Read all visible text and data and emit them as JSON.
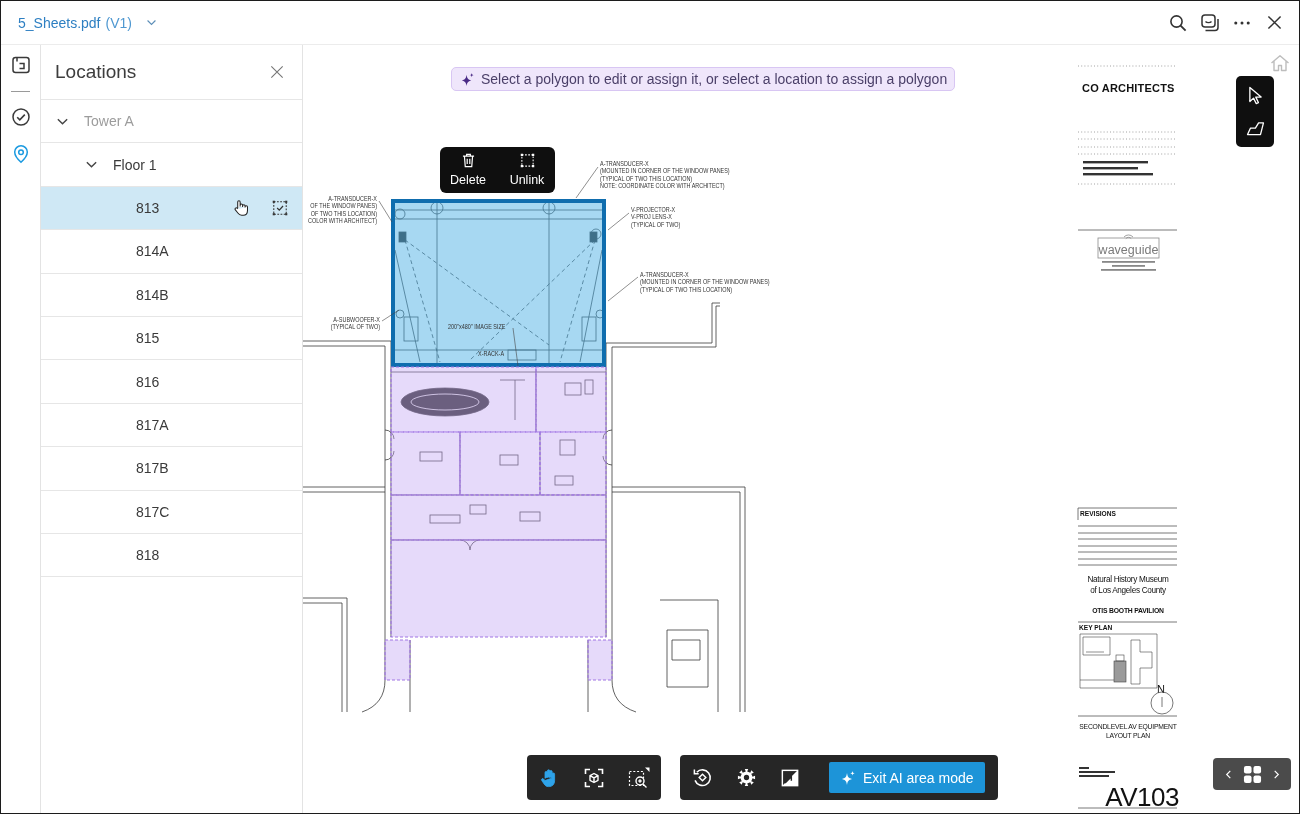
{
  "header": {
    "file_name": "5_Sheets.pdf",
    "version": "(V1)"
  },
  "rail": [
    {
      "kind": "sheets",
      "selected": false
    },
    {
      "kind": "issues",
      "selected": false
    },
    {
      "kind": "locations",
      "selected": true
    }
  ],
  "panel": {
    "title": "Locations",
    "tree": [
      {
        "label": "Tower A",
        "expanded": true,
        "selected": false,
        "disabled": true,
        "children": [
          {
            "label": "Floor 1",
            "expanded": true,
            "selected": false,
            "disabled": false,
            "children": [
              {
                "label": "813",
                "selected": true,
                "disabled": false,
                "hovered": true,
                "linked": true
              },
              {
                "label": "814A",
                "selected": false,
                "disabled": false,
                "hovered": false,
                "linked": false
              },
              {
                "label": "814B",
                "selected": false,
                "disabled": false,
                "hovered": false,
                "linked": false
              },
              {
                "label": "815",
                "selected": false,
                "disabled": false,
                "hovered": false,
                "linked": false
              },
              {
                "label": "816",
                "selected": false,
                "disabled": false,
                "hovered": false,
                "linked": false
              },
              {
                "label": "817A",
                "selected": false,
                "disabled": false,
                "hovered": false,
                "linked": false
              },
              {
                "label": "817B",
                "selected": false,
                "disabled": false,
                "hovered": false,
                "linked": false
              },
              {
                "label": "817C",
                "selected": false,
                "disabled": false,
                "hovered": false,
                "linked": false
              },
              {
                "label": "818",
                "selected": false,
                "disabled": false,
                "hovered": false,
                "linked": false
              }
            ]
          }
        ]
      }
    ]
  },
  "canvas": {
    "hint": "Select a polygon to edit or assign it, or select a location to assign a polygon",
    "polygon_menu": [
      {
        "kind": "delete",
        "label": "Delete"
      },
      {
        "kind": "unlink",
        "label": "Unlink"
      }
    ],
    "tools": [
      {
        "kind": "select"
      },
      {
        "kind": "polygon"
      }
    ],
    "sheet": {
      "polygons": [
        {
          "selected": true
        },
        {
          "selected": false
        },
        {
          "selected": false
        },
        {
          "selected": false
        },
        {
          "selected": false
        },
        {
          "selected": false
        },
        {
          "selected": false
        },
        {
          "selected": false
        },
        {
          "selected": false
        },
        {
          "selected": false
        }
      ],
      "notes": [
        {
          "lines": [
            "A-TRANSDUCER-X",
            "(MOUNTED IN CORNER OF THE WINDOW PANES)",
            "(TYPICAL OF TWO THIS LOCATION)",
            "NOTE: COORDINATE COLOR WITH ARCHITECT)"
          ]
        },
        {
          "lines": [
            "A-TRANSDUCER-X",
            "OF THE WINDOW PANES)",
            "OF TWO THIS LOCATION)",
            "COLOR WITH ARCHITECT)"
          ]
        },
        {
          "lines": [
            "V-PROJECTOR-X",
            "V-PROJ LENS-X",
            "(TYPICAL OF TWO)"
          ]
        },
        {
          "lines": [
            "A-TRANSDUCER-X",
            "(MOUNTED IN CORNER OF THE WINDOW PANES)",
            "(TYPICAL OF TWO THIS LOCATION)"
          ]
        },
        {
          "lines": [
            "A-SUBWOOFER-X",
            "(TYPICAL OF TWO)"
          ]
        },
        {
          "lines": [
            "200\"x480\" IMAGE SIZE"
          ]
        },
        {
          "lines": [
            "X-RACK-A"
          ]
        }
      ],
      "title_block": {
        "firm": "CO ARCHITECTS",
        "consultant": "waveguide",
        "revisions": "REVISIONS",
        "project": [
          "Natural History Museum",
          "of Los Angeles County"
        ],
        "building": "OTIS BOOTH PAVILION",
        "key_plan": "KEY PLAN",
        "north": "N",
        "sheet_title": [
          "SECONDLEVEL AV EQUIPMENT",
          "LAYOUT PLAN"
        ],
        "sheet_number": "AV103"
      }
    }
  },
  "toolbar": {
    "view_tools": [
      {
        "kind": "pan",
        "selected": true
      },
      {
        "kind": "fit",
        "selected": false
      },
      {
        "kind": "zoom_area",
        "selected": false
      }
    ],
    "actions": [
      {
        "kind": "rotate"
      },
      {
        "kind": "settings"
      },
      {
        "kind": "fullscreen"
      }
    ],
    "exit_button": "Exit AI area mode"
  }
}
